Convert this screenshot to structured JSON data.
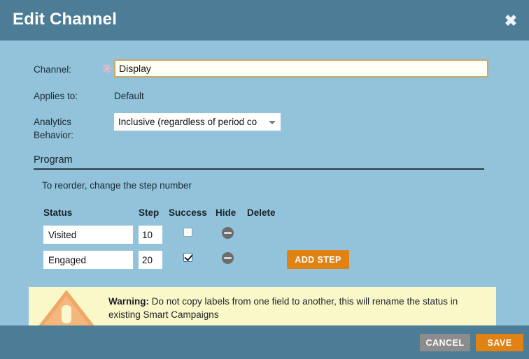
{
  "dialog": {
    "title": "Edit Channel",
    "close_icon": "close-icon"
  },
  "form": {
    "channel": {
      "label": "Channel:",
      "required_marker": "✳",
      "value": "Display",
      "placeholder": ""
    },
    "applies_to": {
      "label": "Applies to:",
      "value": "Default"
    },
    "analytics_behavior": {
      "label_line1": "Analytics",
      "label_line2": "Behavior:",
      "selected": "Inclusive (regardless of period co",
      "arrow_icon": "chevron-down-icon"
    }
  },
  "program": {
    "heading": "Program",
    "reorder_note": "To reorder, change the step number",
    "columns": {
      "status": "Status",
      "step": "Step",
      "success": "Success",
      "hide": "Hide",
      "delete": "Delete"
    },
    "rows": [
      {
        "status": "Visited",
        "step": "10",
        "success": false,
        "delete_icon": "minus-circle-icon"
      },
      {
        "status": "Engaged",
        "step": "20",
        "success": true,
        "delete_icon": "minus-circle-icon"
      }
    ],
    "add_step_label": "ADD STEP",
    "ghost_status_label": "Status"
  },
  "warning": {
    "icon": "warning-triangle-icon",
    "bold_prefix": "Warning:",
    "message": " Do not copy labels from one field to another, this will rename the status in existing Smart Campaigns"
  },
  "footer": {
    "cancel_label": "CANCEL",
    "save_label": "SAVE"
  },
  "colors": {
    "titlebar": "#4d7d96",
    "body": "#92c3da",
    "accent_orange": "#e08214",
    "cancel_gray": "#8c8c8c",
    "warning_bg": "#faf8c8",
    "focus_border": "#c8a96a"
  }
}
